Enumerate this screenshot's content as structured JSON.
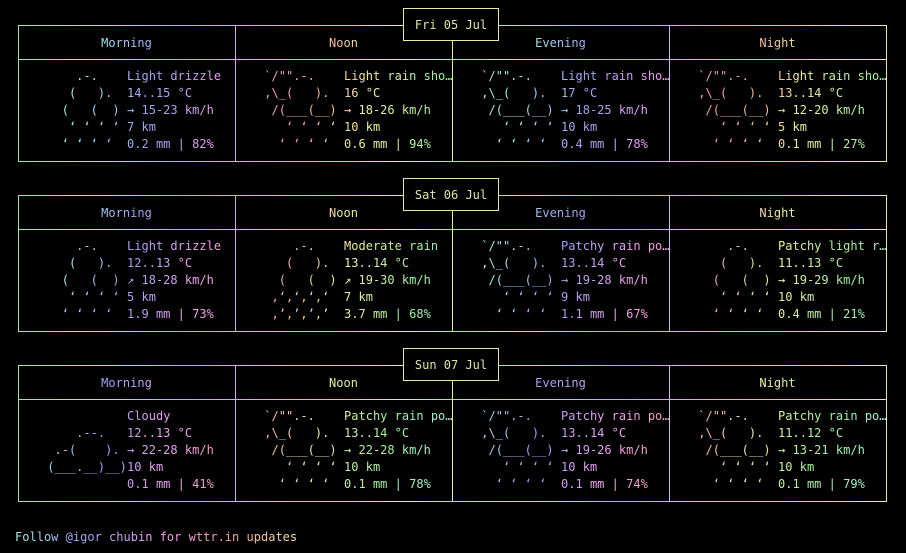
{
  "footer": {
    "text": "Follow @igor_chubin for wttr.in updates",
    "display": "Follow @igor chubin for wttr.in updates"
  },
  "periods": [
    "Morning",
    "Noon",
    "Evening",
    "Night"
  ],
  "days": [
    {
      "date": "Fri 05 Jul",
      "slots": [
        {
          "period": "Morning",
          "art": [
            "     .-.     ",
            "    (   ).   ",
            "   (   (  )  ",
            "    ‘ ‘ ‘ ‘  ",
            "   ‘ ‘ ‘ ‘   "
          ],
          "condition": "Light drizzle",
          "temperature": "14..15 °C",
          "wind": "→ 15-23 km/h",
          "visibility": "7 km",
          "precipitation": "0.2 mm | 82%"
        },
        {
          "period": "Noon",
          "art": [
            " `/\"\".-.    ",
            " ,\\_(   ).  ",
            "  /(___(__) ",
            "    ‘ ‘ ‘ ‘ ",
            "   ‘ ‘ ‘ ‘  "
          ],
          "condition": "Light rain sho…",
          "temperature": "16 °C",
          "wind": "→ 18-26 km/h",
          "visibility": "10 km",
          "precipitation": "0.6 mm | 94%"
        },
        {
          "period": "Evening",
          "art": [
            " `/\"\".-.    ",
            " ,\\_(   ).  ",
            "  /(___(__) ",
            "    ‘ ‘ ‘ ‘ ",
            "   ‘ ‘ ‘ ‘  "
          ],
          "condition": "Light rain sho…",
          "temperature": "17 °C",
          "wind": "→ 18-25 km/h",
          "visibility": "10 km",
          "precipitation": "0.4 mm | 78%"
        },
        {
          "period": "Night",
          "art": [
            " `/\"\".-.    ",
            " ,\\_(   ).  ",
            "  /(___(__) ",
            "    ‘ ‘ ‘ ‘ ",
            "   ‘ ‘ ‘ ‘  "
          ],
          "condition": "Light rain sho…",
          "temperature": "13..14 °C",
          "wind": "→ 12-20 km/h",
          "visibility": "5 km",
          "precipitation": "0.1 mm | 27%"
        }
      ]
    },
    {
      "date": "Sat 06 Jul",
      "slots": [
        {
          "period": "Morning",
          "art": [
            "     .-.     ",
            "    (   ).   ",
            "   (   (  )  ",
            "    ‘ ‘ ‘ ‘  ",
            "   ‘ ‘ ‘ ‘   "
          ],
          "condition": "Light drizzle",
          "temperature": "12..13 °C",
          "wind": "↗ 18-28 km/h",
          "visibility": "5 km",
          "precipitation": "1.9 mm | 73%"
        },
        {
          "period": "Noon",
          "art": [
            "     .-.     ",
            "    (   ).   ",
            "   (   (  )  ",
            "  ‚‘‚‘‚‘‚‘  ",
            "  ‚’‚’‚’‚’  "
          ],
          "condition": "Moderate rain",
          "temperature": "13..14 °C",
          "wind": "↗ 19-30 km/h",
          "visibility": "7 km",
          "precipitation": "3.7 mm | 68%"
        },
        {
          "period": "Evening",
          "art": [
            " `/\"\".-.    ",
            " ,\\_(   ).  ",
            "  /(___(__) ",
            "    ‘ ‘ ‘ ‘ ",
            "   ‘ ‘ ‘ ‘  "
          ],
          "condition": "Patchy rain po…",
          "temperature": "13..14 °C",
          "wind": "→ 19-28 km/h",
          "visibility": "9 km",
          "precipitation": "1.1 mm | 67%"
        },
        {
          "period": "Night",
          "art": [
            "     .-.     ",
            "    (   ).   ",
            "   (   (  )  ",
            "    ‘ ‘ ‘ ‘  ",
            "   ‘ ‘ ‘ ‘   "
          ],
          "condition": "Patchy light r…",
          "temperature": "11..13 °C",
          "wind": "→ 19-29 km/h",
          "visibility": "10 km",
          "precipitation": "0.4 mm | 21%"
        }
      ]
    },
    {
      "date": "Sun 07 Jul",
      "slots": [
        {
          "period": "Morning",
          "art": [
            "             ",
            "     .--.    ",
            "  .-(    ).  ",
            " (___.__)__) ",
            "             "
          ],
          "condition": "Cloudy",
          "temperature": "12..13 °C",
          "wind": "→ 22-28 km/h",
          "visibility": "10 km",
          "precipitation": "0.1 mm | 41%"
        },
        {
          "period": "Noon",
          "art": [
            " `/\"\".-.    ",
            " ,\\_(   ).  ",
            "  /(___(__) ",
            "    ‘ ‘ ‘ ‘ ",
            "   ‘ ‘ ‘ ‘  "
          ],
          "condition": "Patchy rain po…",
          "temperature": "13..14 °C",
          "wind": "→ 22-28 km/h",
          "visibility": "10 km",
          "precipitation": "0.1 mm | 78%"
        },
        {
          "period": "Evening",
          "art": [
            " `/\"\".-.    ",
            " ,\\_(   ).  ",
            "  /(___(__) ",
            "    ‘ ‘ ‘ ‘ ",
            "   ‘ ‘ ‘ ‘  "
          ],
          "condition": "Patchy rain po…",
          "temperature": "13..14 °C",
          "wind": "→ 19-26 km/h",
          "visibility": "10 km",
          "precipitation": "0.1 mm | 74%"
        },
        {
          "period": "Night",
          "art": [
            " `/\"\".-.    ",
            " ,\\_(   ).  ",
            "  /(___(__) ",
            "    ‘ ‘ ‘ ‘ ",
            "   ‘ ‘ ‘ ‘  "
          ],
          "condition": "Patchy rain po…",
          "temperature": "11..12 °C",
          "wind": "→ 13-21 km/h",
          "visibility": "10 km",
          "precipitation": "0.1 mm | 79%"
        }
      ]
    }
  ]
}
